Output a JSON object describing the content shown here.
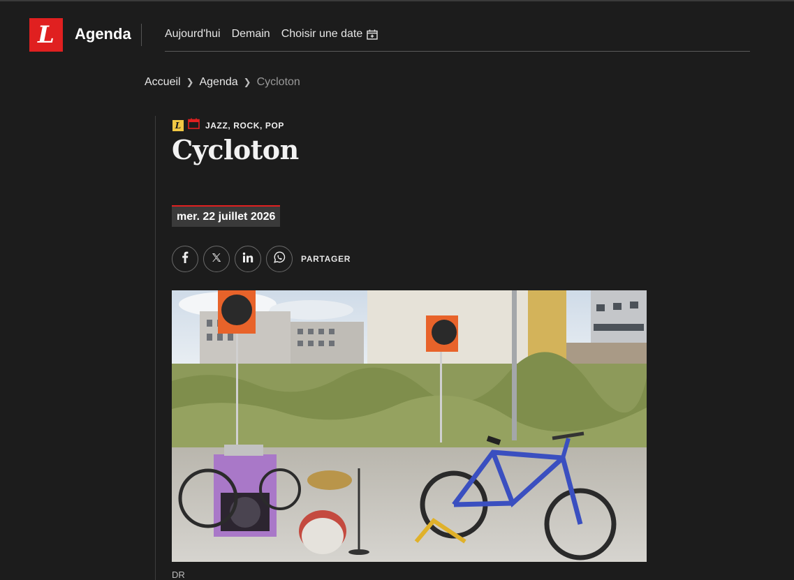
{
  "header": {
    "logo_letter": "L",
    "section_title": "Agenda",
    "nav": {
      "today": "Aujourd'hui",
      "tomorrow": "Demain",
      "choose_date": "Choisir une date"
    }
  },
  "breadcrumb": {
    "home": "Accueil",
    "agenda": "Agenda",
    "current": "Cycloton"
  },
  "event": {
    "badge_letter": "L",
    "category": "JAZZ, ROCK, POP",
    "title": "Cycloton",
    "date": "mer. 22 juillet 2026",
    "share_label": "PARTAGER",
    "photo_credit": "DR"
  },
  "colors": {
    "background": "#1c1c1c",
    "brand_red": "#e02020",
    "badge_yellow": "#f2c744"
  },
  "icons": {
    "share": [
      "facebook-icon",
      "x-icon",
      "linkedin-icon",
      "whatsapp-icon"
    ],
    "nav_calendar": "calendar-plus-icon",
    "category": "calendar-icon"
  }
}
